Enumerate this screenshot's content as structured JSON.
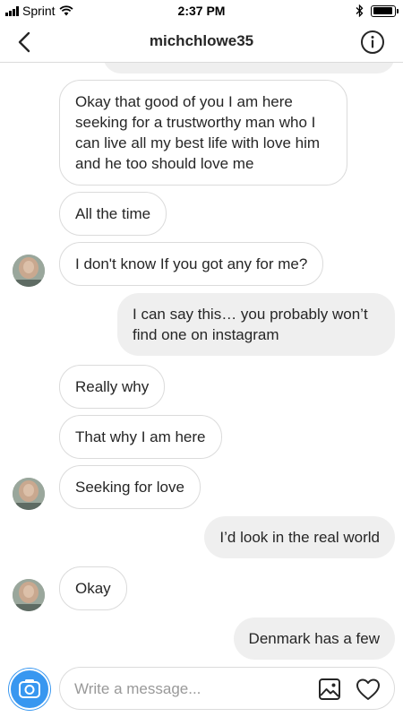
{
  "status_bar": {
    "carrier": "Sprint",
    "time": "2:37 PM",
    "battery_level": 0.95
  },
  "header": {
    "username": "michchlowe35",
    "back_icon": "chevron-left-icon",
    "info_icon": "info-icon"
  },
  "messages": [
    {
      "sender": "other",
      "text": "Okay that good of you I am here seeking for a trustworthy man who I can live all my best life with love him and he too should love me"
    },
    {
      "sender": "other",
      "text": "All the time"
    },
    {
      "sender": "other",
      "text": "I don't know If you got any for me?",
      "avatar": true
    },
    {
      "sender": "me",
      "text": "I can say this… you probably won’t find one on instagram"
    },
    {
      "sender": "other",
      "text": "Really why"
    },
    {
      "sender": "other",
      "text": "That why I am here"
    },
    {
      "sender": "other",
      "text": "Seeking for love",
      "avatar": true
    },
    {
      "sender": "me",
      "text": "I’d look in the real world"
    },
    {
      "sender": "other",
      "text": "Okay",
      "avatar": true
    },
    {
      "sender": "me",
      "text": "Denmark has a few"
    }
  ],
  "composer": {
    "placeholder": "Write a message...",
    "camera_icon": "camera-icon",
    "gallery_icon": "image-icon",
    "like_icon": "heart-icon"
  },
  "colors": {
    "accent": "#3897f0",
    "outgoing_bubble": "#efefef",
    "incoming_border": "#dbdbdb"
  }
}
